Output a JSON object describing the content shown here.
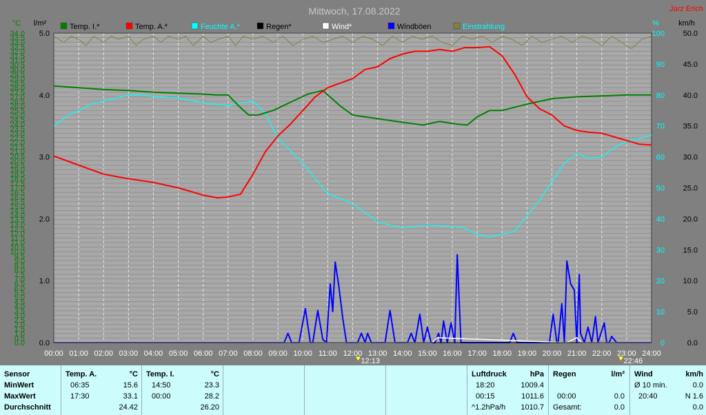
{
  "title": "Mittwoch, 17.08.2022",
  "author": "Jarz Erich",
  "left_axis_units": {
    "temp": "°C",
    "rain": "l/m²"
  },
  "right_axis_units": {
    "hum": "%",
    "wind": "km/h"
  },
  "colors": {
    "temp_inside": "#008000",
    "temp_outside": "#ff0000",
    "humidity": "#00ffff",
    "rain": "#000000",
    "wind": "#ffffff",
    "gusts": "#0000ff",
    "radiation": "#808040",
    "axis_temp": "#008000",
    "axis_hum": "#00ffff",
    "background": "#a8a8a8"
  },
  "legend": [
    {
      "label": "Temp. I.*",
      "color": "#008000",
      "text_color": "#000000"
    },
    {
      "label": "Temp. A.*",
      "color": "#ff0000",
      "text_color": "#000000"
    },
    {
      "label": "Feuchte A.*",
      "color": "#00ffff",
      "text_color": "#00ffff"
    },
    {
      "label": "Regen*",
      "color": "#000000",
      "text_color": "#000000"
    },
    {
      "label": "Wind*",
      "color": "#ffffff",
      "text_color": "#ffffff"
    },
    {
      "label": "Windböen",
      "color": "#0000ff",
      "text_color": "#000000"
    },
    {
      "label": "Einstrahlung",
      "color": "#808040",
      "text_color": "#00ffff"
    }
  ],
  "markers": [
    {
      "time": 12.22,
      "label": "12:13",
      "type": "sunrise"
    },
    {
      "time": 22.77,
      "label": "22:46",
      "type": "sunset"
    }
  ],
  "chart_data": {
    "type": "line",
    "title": "Mittwoch, 17.08.2022",
    "xlabel": "",
    "ylabel": "°C",
    "x_ticks": [
      "00:00",
      "01:00",
      "02:00",
      "03:00",
      "04:00",
      "05:00",
      "06:00",
      "07:00",
      "08:00",
      "09:00",
      "10:00",
      "11:00",
      "12:00",
      "13:00",
      "14:00",
      "15:00",
      "16:00",
      "17:00",
      "18:00",
      "19:00",
      "20:00",
      "21:00",
      "22:00",
      "23:00",
      "24:00"
    ],
    "xlim": [
      0,
      24
    ],
    "axes": {
      "temp": {
        "label": "°C",
        "lim": [
          0.0,
          34.0
        ],
        "step": 0.5
      },
      "rain": {
        "label": "l/m²",
        "lim": [
          0.0,
          5.0
        ],
        "step": 1.0
      },
      "humidity": {
        "label": "%",
        "lim": [
          0,
          100
        ],
        "step": 10
      },
      "wind": {
        "label": "km/h",
        "lim": [
          0.0,
          50.0
        ],
        "step": 5.0
      }
    },
    "grid": true,
    "series": [
      {
        "name": "Temp. I.*",
        "axis": "temp",
        "x": [
          0,
          1,
          2,
          3,
          4,
          5,
          6,
          6.5,
          7,
          7.5,
          7.83,
          8.2,
          8.8,
          9.5,
          10.2,
          10.8,
          11.5,
          12,
          13,
          14,
          14.83,
          15.5,
          16.2,
          16.6,
          17,
          17.5,
          18,
          19,
          20,
          21,
          22,
          23,
          24
        ],
        "y": [
          28.2,
          28,
          27.8,
          27.7,
          27.5,
          27.4,
          27.3,
          27.2,
          27.2,
          25.8,
          25,
          25,
          25.5,
          26.4,
          27.3,
          27.7,
          26,
          25,
          24.6,
          24.2,
          23.9,
          24.3,
          24,
          23.9,
          24.8,
          25.5,
          25.5,
          26.2,
          26.8,
          27,
          27.1,
          27.2,
          27.2
        ]
      },
      {
        "name": "Temp. A.*",
        "axis": "temp",
        "x": [
          0,
          1,
          2,
          3,
          4,
          5,
          6,
          6.58,
          7,
          7.5,
          8,
          8.5,
          9,
          9.5,
          10,
          10.5,
          11,
          11.5,
          12,
          12.5,
          13,
          13.5,
          14,
          14.5,
          15,
          15.5,
          16,
          16.5,
          17,
          17.5,
          18,
          18.5,
          19,
          19.5,
          20,
          20.5,
          21,
          21.5,
          22,
          22.5,
          23,
          23.5,
          24
        ],
        "y": [
          20.5,
          19.5,
          18.5,
          18,
          17.6,
          17,
          16.2,
          15.9,
          16,
          16.3,
          18.5,
          21,
          22.7,
          24,
          25.5,
          27,
          28,
          28.5,
          29,
          30,
          30.3,
          31.2,
          31.7,
          32,
          32,
          32.2,
          32,
          32.4,
          32.4,
          32.5,
          31.5,
          29.5,
          27,
          25.7,
          25,
          23.8,
          23.3,
          23.1,
          23,
          22.6,
          22.2,
          21.8,
          21.7
        ]
      },
      {
        "name": "Feuchte A.*",
        "axis": "humidity",
        "x": [
          0,
          0.5,
          1,
          1.5,
          2,
          2.5,
          3,
          3.5,
          4,
          5,
          6,
          6.5,
          7,
          7.5,
          8,
          8.5,
          9,
          10,
          11,
          12,
          13,
          14,
          15,
          16,
          16.5,
          17,
          17.5,
          18,
          18.5,
          19,
          19.5,
          20,
          20.5,
          21,
          21.5,
          22,
          22.5,
          23,
          23.5,
          24
        ],
        "y": [
          70,
          73,
          75,
          77,
          78,
          79,
          80,
          80,
          79.5,
          79,
          77.5,
          77,
          76.5,
          77.5,
          78,
          74,
          66,
          58,
          48,
          45,
          39,
          37,
          38,
          37.5,
          37,
          35,
          34,
          35,
          36,
          41,
          46,
          52,
          58,
          61,
          59.5,
          60,
          63,
          65,
          66,
          67
        ]
      },
      {
        "name": "Regen*",
        "axis": "rain",
        "x": [
          0,
          24
        ],
        "y": [
          0,
          0
        ]
      },
      {
        "name": "Wind*",
        "axis": "wind",
        "x": [
          0,
          12,
          13,
          15.2,
          15.4,
          20.6,
          21,
          21.2,
          24
        ],
        "y": [
          0,
          0,
          0,
          0,
          0.8,
          0,
          0.8,
          0,
          0
        ]
      },
      {
        "name": "Windböen",
        "axis": "wind",
        "x": [
          0,
          9.25,
          9.4,
          9.55,
          9.85,
          10.1,
          10.3,
          10.4,
          10.6,
          10.8,
          10.95,
          11.1,
          11.2,
          11.3,
          11.45,
          11.6,
          11.75,
          12.2,
          12.35,
          12.5,
          12.6,
          12.75,
          12.9,
          13.3,
          13.5,
          13.7,
          14.2,
          14.35,
          14.5,
          14.7,
          14.85,
          15.0,
          15.15,
          15.3,
          15.45,
          15.55,
          15.65,
          15.8,
          15.95,
          16.1,
          16.2,
          16.35,
          16.5,
          16.7,
          18.3,
          18.45,
          18.6,
          19.9,
          20.05,
          20.2,
          20.25,
          20.4,
          20.5,
          20.6,
          20.75,
          20.9,
          21.0,
          21.1,
          21.15,
          21.3,
          21.45,
          21.6,
          21.75,
          21.85,
          22.1,
          22.2,
          22.3,
          22.4,
          22.6,
          22.75,
          24
        ],
        "y": [
          0,
          0,
          1.5,
          0,
          0,
          5.5,
          0,
          0,
          5.2,
          0.5,
          0,
          9.5,
          5,
          13,
          9,
          4,
          0,
          0,
          1.5,
          0,
          1.5,
          0,
          0,
          0,
          5.2,
          0,
          0,
          1.5,
          0,
          4.6,
          0,
          2.5,
          0,
          0,
          1.5,
          0,
          3.5,
          0,
          3.2,
          0,
          14.2,
          0,
          0,
          0,
          0,
          1.5,
          0,
          0,
          4.6,
          0,
          0,
          6.3,
          0,
          13.2,
          9.5,
          8.5,
          0,
          11,
          1.5,
          0,
          2.5,
          0,
          4.2,
          0,
          3.2,
          0,
          0,
          1,
          0,
          0,
          0
        ]
      },
      {
        "name": "Einstrahlung",
        "axis": "humidity",
        "x": [
          0,
          0.4,
          0.7,
          1,
          1.3,
          1.6,
          2,
          2.3,
          2.6,
          3,
          3.3,
          3.6,
          4,
          4.3,
          4.6,
          5,
          5.3,
          5.6,
          6,
          6.3,
          6.6,
          7,
          7.3,
          7.6,
          8,
          8.4,
          8.8,
          9.2,
          9.6,
          10,
          10.4,
          10.8,
          11.2,
          11.6,
          12,
          12.4,
          12.8,
          13.2,
          13.6,
          14,
          14.4,
          14.8,
          15.2,
          15.6,
          16,
          16.4,
          16.8,
          17.2,
          17.6,
          18,
          18.4,
          18.8,
          19.2,
          19.6,
          20,
          20.4,
          20.8,
          21.2,
          21.6,
          22,
          22.4,
          22.8,
          23.2,
          23.6,
          24
        ],
        "y": [
          99,
          97,
          99,
          98,
          96,
          99,
          97,
          99,
          98,
          99,
          96,
          98,
          99,
          97,
          99,
          98,
          99,
          96,
          99,
          97,
          98,
          99,
          96,
          99,
          98,
          99,
          97,
          99,
          96,
          98,
          99,
          97,
          98,
          99,
          97,
          99,
          98,
          96,
          99,
          97,
          99,
          98,
          99,
          97,
          96,
          99,
          98,
          99,
          97,
          99,
          98,
          96,
          99,
          97,
          98,
          99,
          97,
          99,
          98,
          96,
          99,
          97,
          95,
          98,
          99
        ]
      }
    ]
  },
  "stats": {
    "headers": {
      "sensor": "Sensor",
      "temp_a": "Temp. A.",
      "unit_c": "°C",
      "temp_i": "Temp. I.",
      "pressure": "Luftdruck",
      "unit_hpa": "hPa",
      "rain": "Regen",
      "unit_rain": "l/m²",
      "wind": "Wind",
      "unit_kmh": "km/h"
    },
    "rows": [
      {
        "label": "MinWert",
        "ta_time": "06:35",
        "ta_val": "15.6",
        "ti_time": "14:50",
        "ti_val": "23.3",
        "p_time": "18:20",
        "p_val": "1009.4",
        "r_time": "",
        "r_val": "",
        "w_time": "Ø 10 min.",
        "w_val": "0.0"
      },
      {
        "label": "MaxWert",
        "ta_time": "17:30",
        "ta_val": "33.1",
        "ti_time": "00:00",
        "ti_val": "28.2",
        "p_time": "00:15",
        "p_val": "1011.6",
        "r_time": "00:00",
        "r_val": "0.0",
        "w_time": "20:40",
        "w_val": "N 1.6"
      },
      {
        "label": "Durchschnitt",
        "ta_time": "",
        "ta_val": "24.42",
        "ti_time": "",
        "ti_val": "26.20",
        "p_time": "^1.2hPa/h",
        "p_val": "1010.7",
        "r_time": "Gesamt:",
        "r_val": "0.0",
        "w_time": "",
        "w_val": "0.0"
      }
    ]
  }
}
